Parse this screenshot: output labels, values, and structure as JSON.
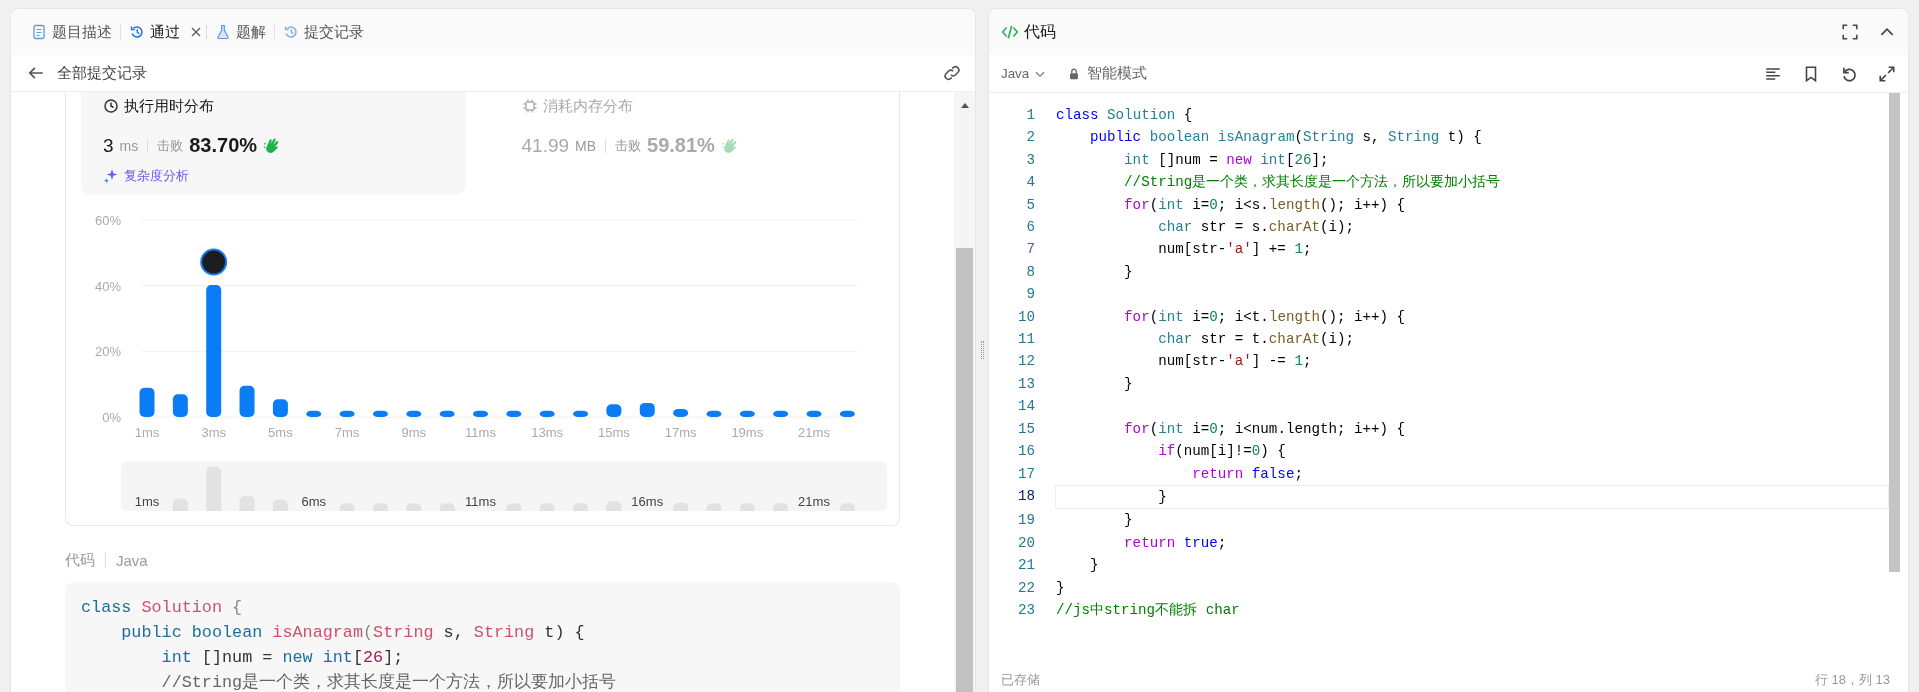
{
  "left_panel": {
    "tabs": [
      {
        "label": "题目描述",
        "selected": false
      },
      {
        "label": "通过",
        "selected": true
      },
      {
        "label": "题解",
        "selected": false
      },
      {
        "label": "提交记录",
        "selected": false
      }
    ],
    "back_link": "全部提交记录",
    "stats": [
      {
        "title": "执行用时分布",
        "value": "3",
        "unit": "ms",
        "beats_label": "击败",
        "beats": "83.70%",
        "selected": true
      },
      {
        "title": "消耗内存分布",
        "value": "41.99",
        "unit": "MB",
        "beats_label": "击败",
        "beats": "59.81%",
        "selected": false
      }
    ],
    "analysis_link": "复杂度分析",
    "chart_data": {
      "type": "bar",
      "categories": [
        "1ms",
        null,
        "3ms",
        null,
        "5ms",
        null,
        "7ms",
        null,
        "9ms",
        null,
        "11ms",
        null,
        "13ms",
        null,
        "15ms",
        null,
        "17ms",
        null,
        "19ms",
        null,
        "21ms",
        null
      ],
      "values": [
        8.9,
        6.9,
        40.2,
        9.5,
        5.4,
        1.9,
        1.9,
        1.9,
        1.9,
        1.9,
        1.9,
        1.9,
        1.9,
        1.9,
        3.9,
        4.3,
        2.4,
        1.9,
        1.9,
        1.9,
        1.9,
        1.9
      ],
      "ylim": [
        0,
        60
      ],
      "yticks": [
        {
          "value": 0,
          "label": "0%"
        },
        {
          "value": 20,
          "label": "20%"
        },
        {
          "value": 40,
          "label": "40%"
        },
        {
          "value": 60,
          "label": "60%"
        }
      ]
    },
    "navigator_labels": [
      "1ms",
      "6ms",
      "11ms",
      "16ms",
      "21ms"
    ],
    "code_label": "代码",
    "code_language": "Java",
    "code_lines": [
      [
        {
          "text": "class",
          "kind": "kw"
        },
        {
          "text": " Solution",
          "kind": "name"
        },
        {
          "text": " {",
          "kind": "punct"
        }
      ],
      [
        {
          "text": "    public",
          "kind": "kw"
        },
        {
          "text": " boolean",
          "kind": "kw"
        },
        {
          "text": " isAnagram",
          "kind": "name"
        },
        {
          "text": "(",
          "kind": "punct"
        },
        {
          "text": "String",
          "kind": "name"
        },
        {
          "text": " s, ",
          "kind": "plain"
        },
        {
          "text": "String",
          "kind": "name"
        },
        {
          "text": " t) {",
          "kind": "plain"
        }
      ],
      [
        {
          "text": "        int",
          "kind": "kw"
        },
        {
          "text": " []num = ",
          "kind": "plain"
        },
        {
          "text": "new",
          "kind": "kw"
        },
        {
          "text": " int",
          "kind": "kw"
        },
        {
          "text": "[",
          "kind": "plain"
        },
        {
          "text": "26",
          "kind": "num"
        },
        {
          "text": "];",
          "kind": "plain"
        }
      ],
      [
        {
          "text": "        //String是一个类，求其长度是一个方法，所以要加小括号",
          "kind": "cmt"
        }
      ]
    ]
  },
  "right_panel": {
    "title": "代码",
    "language": "Java",
    "mode": "智能模式",
    "lines": [
      {
        "number": "1",
        "current": false,
        "tokens": [
          {
            "text": "class",
            "kind": "kw"
          },
          {
            "text": " Solution",
            "kind": "type"
          },
          {
            "text": " {",
            "kind": "plain"
          }
        ]
      },
      {
        "number": "2",
        "current": false,
        "tokens": [
          {
            "text": "    public",
            "kind": "kw"
          },
          {
            "text": " boolean",
            "kind": "type"
          },
          {
            "text": " isAnagram",
            "kind": "type"
          },
          {
            "text": "(",
            "kind": "plain"
          },
          {
            "text": "String",
            "kind": "type"
          },
          {
            "text": " s, ",
            "kind": "plain"
          },
          {
            "text": "String",
            "kind": "type"
          },
          {
            "text": " t) {",
            "kind": "plain"
          }
        ]
      },
      {
        "number": "3",
        "current": false,
        "tokens": [
          {
            "text": "        int",
            "kind": "type"
          },
          {
            "text": " []num = ",
            "kind": "plain"
          },
          {
            "text": "new",
            "kind": "ctrl"
          },
          {
            "text": " int",
            "kind": "type"
          },
          {
            "text": "[",
            "kind": "plain"
          },
          {
            "text": "26",
            "kind": "num"
          },
          {
            "text": "];",
            "kind": "plain"
          }
        ]
      },
      {
        "number": "4",
        "current": false,
        "tokens": [
          {
            "text": "        //String是一个类，求其长度是一个方法，所以要加小括号",
            "kind": "cmt"
          }
        ]
      },
      {
        "number": "5",
        "current": false,
        "tokens": [
          {
            "text": "        for",
            "kind": "ctrl"
          },
          {
            "text": "(",
            "kind": "plain"
          },
          {
            "text": "int",
            "kind": "type"
          },
          {
            "text": " i=",
            "kind": "plain"
          },
          {
            "text": "0",
            "kind": "num"
          },
          {
            "text": "; i<s.",
            "kind": "plain"
          },
          {
            "text": "length",
            "kind": "fn"
          },
          {
            "text": "(); i++) {",
            "kind": "plain"
          }
        ]
      },
      {
        "number": "6",
        "current": false,
        "tokens": [
          {
            "text": "            char",
            "kind": "type"
          },
          {
            "text": " str = s.",
            "kind": "plain"
          },
          {
            "text": "charAt",
            "kind": "fn"
          },
          {
            "text": "(i);",
            "kind": "plain"
          }
        ]
      },
      {
        "number": "7",
        "current": false,
        "tokens": [
          {
            "text": "            num[str-",
            "kind": "plain"
          },
          {
            "text": "'a'",
            "kind": "str"
          },
          {
            "text": "] += ",
            "kind": "plain"
          },
          {
            "text": "1",
            "kind": "num"
          },
          {
            "text": ";",
            "kind": "plain"
          }
        ]
      },
      {
        "number": "8",
        "current": false,
        "tokens": [
          {
            "text": "        }",
            "kind": "plain"
          }
        ]
      },
      {
        "number": "9",
        "current": false
      },
      {
        "number": "10",
        "current": false,
        "tokens": [
          {
            "text": "        for",
            "kind": "ctrl"
          },
          {
            "text": "(",
            "kind": "plain"
          },
          {
            "text": "int",
            "kind": "type"
          },
          {
            "text": " i=",
            "kind": "plain"
          },
          {
            "text": "0",
            "kind": "num"
          },
          {
            "text": "; i<t.",
            "kind": "plain"
          },
          {
            "text": "length",
            "kind": "fn"
          },
          {
            "text": "(); i++) {",
            "kind": "plain"
          }
        ]
      },
      {
        "number": "11",
        "current": false,
        "tokens": [
          {
            "text": "            char",
            "kind": "type"
          },
          {
            "text": " str = t.",
            "kind": "plain"
          },
          {
            "text": "charAt",
            "kind": "fn"
          },
          {
            "text": "(i);",
            "kind": "plain"
          }
        ]
      },
      {
        "number": "12",
        "current": false,
        "tokens": [
          {
            "text": "            num[str-",
            "kind": "plain"
          },
          {
            "text": "'a'",
            "kind": "str"
          },
          {
            "text": "] -= ",
            "kind": "plain"
          },
          {
            "text": "1",
            "kind": "num"
          },
          {
            "text": ";",
            "kind": "plain"
          }
        ]
      },
      {
        "number": "13",
        "current": false,
        "tokens": [
          {
            "text": "        }",
            "kind": "plain"
          }
        ]
      },
      {
        "number": "14",
        "current": false
      },
      {
        "number": "15",
        "current": false,
        "tokens": [
          {
            "text": "        for",
            "kind": "ctrl"
          },
          {
            "text": "(",
            "kind": "plain"
          },
          {
            "text": "int",
            "kind": "type"
          },
          {
            "text": " i=",
            "kind": "plain"
          },
          {
            "text": "0",
            "kind": "num"
          },
          {
            "text": "; i<num.length; i++) {",
            "kind": "plain"
          }
        ]
      },
      {
        "number": "16",
        "current": false,
        "tokens": [
          {
            "text": "            if",
            "kind": "ctrl"
          },
          {
            "text": "(num[i]!=",
            "kind": "plain"
          },
          {
            "text": "0",
            "kind": "num"
          },
          {
            "text": ") {",
            "kind": "plain"
          }
        ]
      },
      {
        "number": "17",
        "current": false,
        "tokens": [
          {
            "text": "                return",
            "kind": "ctrl"
          },
          {
            "text": " false",
            "kind": "kw"
          },
          {
            "text": ";",
            "kind": "plain"
          }
        ]
      },
      {
        "number": "18",
        "current": true,
        "tokens": [
          {
            "text": "            }",
            "kind": "plain"
          }
        ]
      },
      {
        "number": "19",
        "current": false,
        "tokens": [
          {
            "text": "        }",
            "kind": "plain"
          }
        ]
      },
      {
        "number": "20",
        "current": false,
        "tokens": [
          {
            "text": "        return",
            "kind": "ctrl"
          },
          {
            "text": " true",
            "kind": "kw"
          },
          {
            "text": ";",
            "kind": "plain"
          }
        ]
      },
      {
        "number": "21",
        "current": false,
        "tokens": [
          {
            "text": "    }",
            "kind": "plain"
          }
        ]
      },
      {
        "number": "22",
        "current": false,
        "tokens": [
          {
            "text": "}",
            "kind": "plain"
          }
        ]
      },
      {
        "number": "23",
        "current": false,
        "tokens": [
          {
            "text": "//js中string不能拆 char",
            "kind": "cmt"
          }
        ]
      }
    ],
    "status": "已存储",
    "cursor": "行 18，列 13"
  }
}
